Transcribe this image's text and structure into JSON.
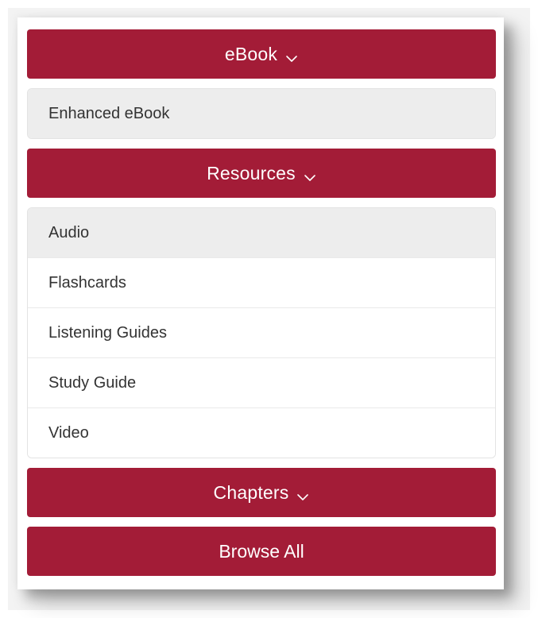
{
  "colors": {
    "header_bg": "#a31c37",
    "header_text": "#ffffff",
    "item_active_bg": "#ededed",
    "item_text": "#333333"
  },
  "sections": [
    {
      "label": "eBook",
      "icon": "chevron-down-icon",
      "items": [
        {
          "label": "Enhanced eBook"
        }
      ]
    },
    {
      "label": "Resources",
      "icon": "chevron-down-icon",
      "items": [
        {
          "label": "Audio"
        },
        {
          "label": "Flashcards"
        },
        {
          "label": "Listening Guides"
        },
        {
          "label": "Study Guide"
        },
        {
          "label": "Video"
        }
      ]
    },
    {
      "label": "Chapters",
      "icon": "chevron-down-icon",
      "items": []
    }
  ],
  "browse_all": {
    "label": "Browse All"
  }
}
